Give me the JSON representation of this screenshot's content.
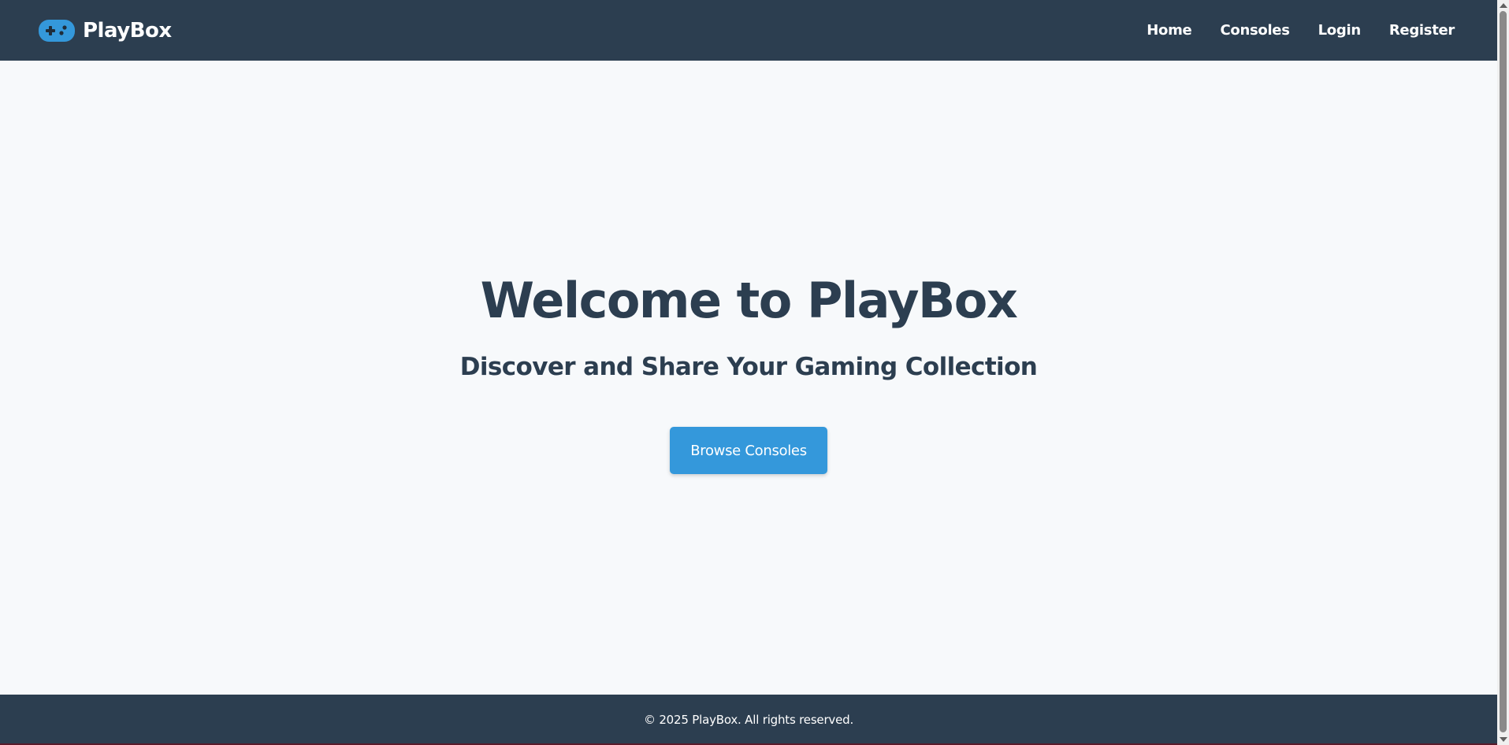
{
  "navbar": {
    "brand_name": "PlayBox",
    "brand_icon": "gamepad-icon",
    "links": [
      {
        "label": "Home"
      },
      {
        "label": "Consoles"
      },
      {
        "label": "Login"
      },
      {
        "label": "Register"
      }
    ]
  },
  "hero": {
    "title": "Welcome to PlayBox",
    "subtitle": "Discover and Share Your Gaming Collection",
    "cta_label": "Browse Consoles"
  },
  "footer": {
    "copyright": "© 2025 PlayBox. All rights reserved."
  },
  "colors": {
    "nav_bg": "#2c3e50",
    "accent": "#3498db",
    "page_bg": "#f7f9fb",
    "heading": "#2c3e50"
  }
}
